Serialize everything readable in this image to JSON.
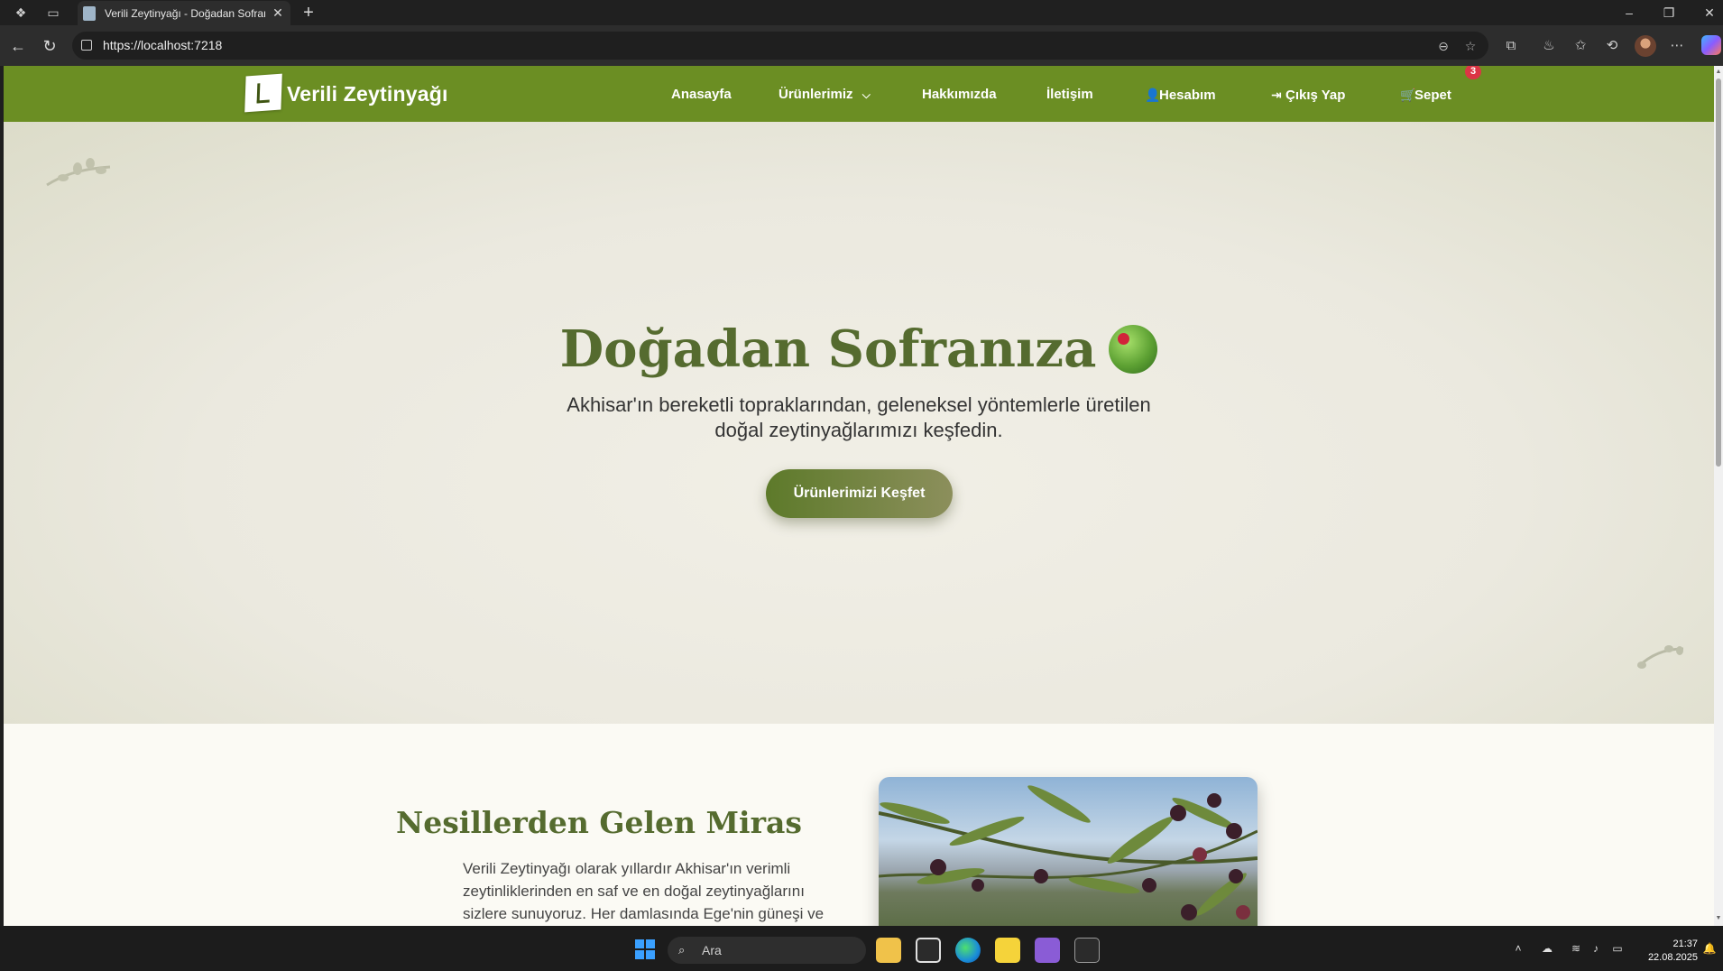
{
  "browser": {
    "tab_title": "Verili Zeytinyağı - Doğadan Sofranıza",
    "url": "https://localhost:7218"
  },
  "site": {
    "brand": "Verili Zeytinyağı",
    "nav": {
      "home": "Anasayfa",
      "products": "Ürünlerimiz",
      "about": "Hakkımızda",
      "contact": "İletişim",
      "account": "Hesabım",
      "logout": "Çıkış Yap",
      "cart": "Sepet",
      "cart_count": "3"
    },
    "hero": {
      "title": "Doğadan Sofranıza",
      "subtitle": "Akhisar'ın bereketli topraklarından, geleneksel yöntemlerle üretilen doğal zeytinyağlarımızı keşfedin.",
      "cta": "Ürünlerimizi Keşfet"
    },
    "heritage": {
      "title": "Nesillerden Gelen Miras",
      "text": "Verili Zeytinyağı olarak yıllardır Akhisar'ın verimli zeytinliklerinden en saf ve en doğal zeytinyağlarını sizlere sunuyoruz. Her damlasında Ege'nin güneşi ve"
    },
    "colors": {
      "brand_green": "#6b8e23",
      "heading_olive": "#556b2f",
      "badge_red": "#dc3545"
    }
  },
  "taskbar": {
    "search_placeholder": "Ara",
    "time": "21:37",
    "date": "22.08.2025"
  }
}
